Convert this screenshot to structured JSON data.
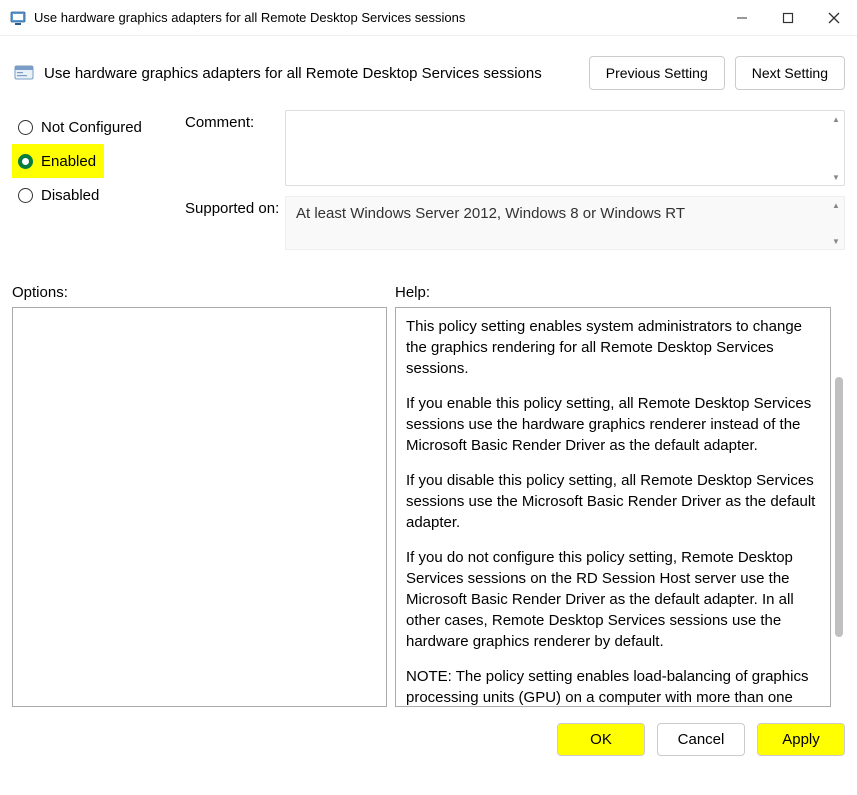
{
  "window": {
    "title": "Use hardware graphics adapters for all Remote Desktop Services sessions"
  },
  "header": {
    "title": "Use hardware graphics adapters for all Remote Desktop Services sessions",
    "previous": "Previous Setting",
    "next": "Next Setting"
  },
  "radios": {
    "not_configured": "Not Configured",
    "enabled": "Enabled",
    "disabled": "Disabled"
  },
  "fields": {
    "comment_label": "Comment:",
    "comment_value": "",
    "supported_label": "Supported on:",
    "supported_value": "At least Windows Server 2012, Windows 8 or Windows RT"
  },
  "sections": {
    "options_label": "Options:",
    "help_label": "Help:"
  },
  "help": {
    "p1": "This policy setting enables system administrators to change the graphics rendering for all Remote Desktop Services sessions.",
    "p2": "If you enable this policy setting, all Remote Desktop Services sessions use the hardware graphics renderer instead of the Microsoft Basic Render Driver as the default adapter.",
    "p3": "If you disable this policy setting, all Remote Desktop Services sessions use the Microsoft Basic Render Driver as the default adapter.",
    "p4": "If you do not configure this policy setting, Remote Desktop Services sessions on the RD Session Host server use the Microsoft Basic Render Driver as the default adapter. In all other cases, Remote Desktop Services sessions use the hardware graphics renderer by default.",
    "p5": "NOTE: The policy setting enables load-balancing of graphics processing units (GPU) on a computer with more than one GPU installed. The GPU configuration of the local session is not"
  },
  "footer": {
    "ok": "OK",
    "cancel": "Cancel",
    "apply": "Apply"
  }
}
